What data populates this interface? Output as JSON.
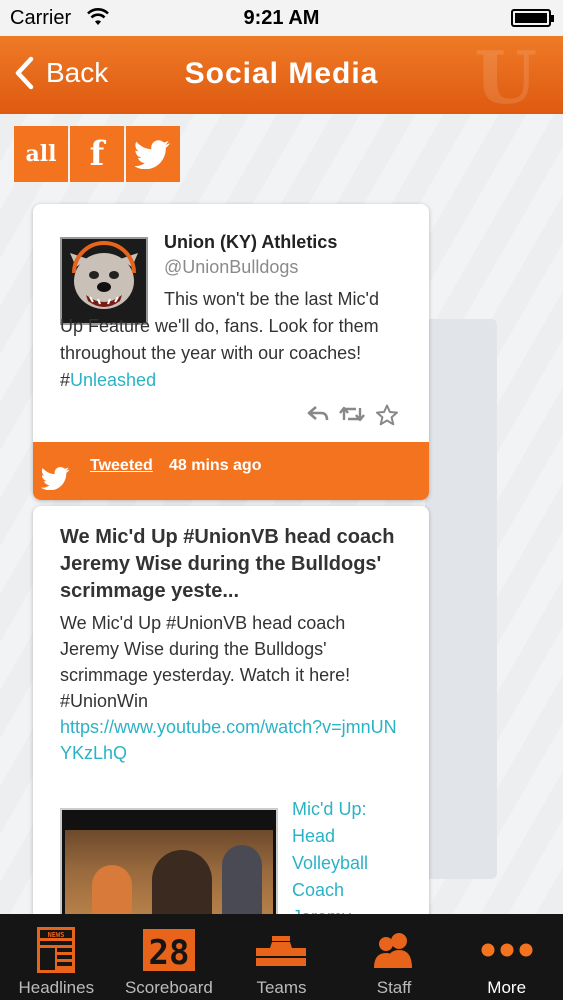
{
  "status_bar": {
    "carrier": "Carrier",
    "time": "9:21 AM"
  },
  "nav": {
    "back_label": "Back",
    "title": "Social Media",
    "logo_letter": "U"
  },
  "filters": [
    {
      "label": "all",
      "icon": "all-text"
    },
    {
      "label": "f",
      "icon": "facebook-icon"
    },
    {
      "label": "",
      "icon": "twitter-icon"
    }
  ],
  "tweet": {
    "name": "Union (KY) Athletics",
    "handle": "@UnionBulldogs",
    "text": "This won't be the last Mic'd Up Feature we'll do, fans. Look for them throughout the year with our coaches! #",
    "hashtag": "Unleashed",
    "footer_link": "Tweeted",
    "footer_time": "48 mins ago"
  },
  "post": {
    "headline": "We Mic'd Up #UnionVB head coach Jeremy Wise during the Bulldogs' scrimmage yeste...",
    "body": "We Mic'd Up #UnionVB head coach Jeremy Wise during the Bulldogs' scrimmage yesterday. Watch it here! #UnionWin",
    "link": "https://www.youtube.com/watch?v=jmnUNYKzLhQ",
    "video_title": "Mic'd Up: Head Volleyball Coach Jeremy"
  },
  "tabs": [
    {
      "label": "Headlines",
      "icon": "news-icon"
    },
    {
      "label": "Scoreboard",
      "icon": "scoreboard-icon"
    },
    {
      "label": "Teams",
      "icon": "podium-icon"
    },
    {
      "label": "Staff",
      "icon": "people-icon"
    },
    {
      "label": "More",
      "icon": "more-dots-icon",
      "active": true
    }
  ],
  "colors": {
    "accent": "#f4731f",
    "nav": "#e66a1a",
    "link": "#2ab3c6",
    "tab_bar": "#151515"
  }
}
